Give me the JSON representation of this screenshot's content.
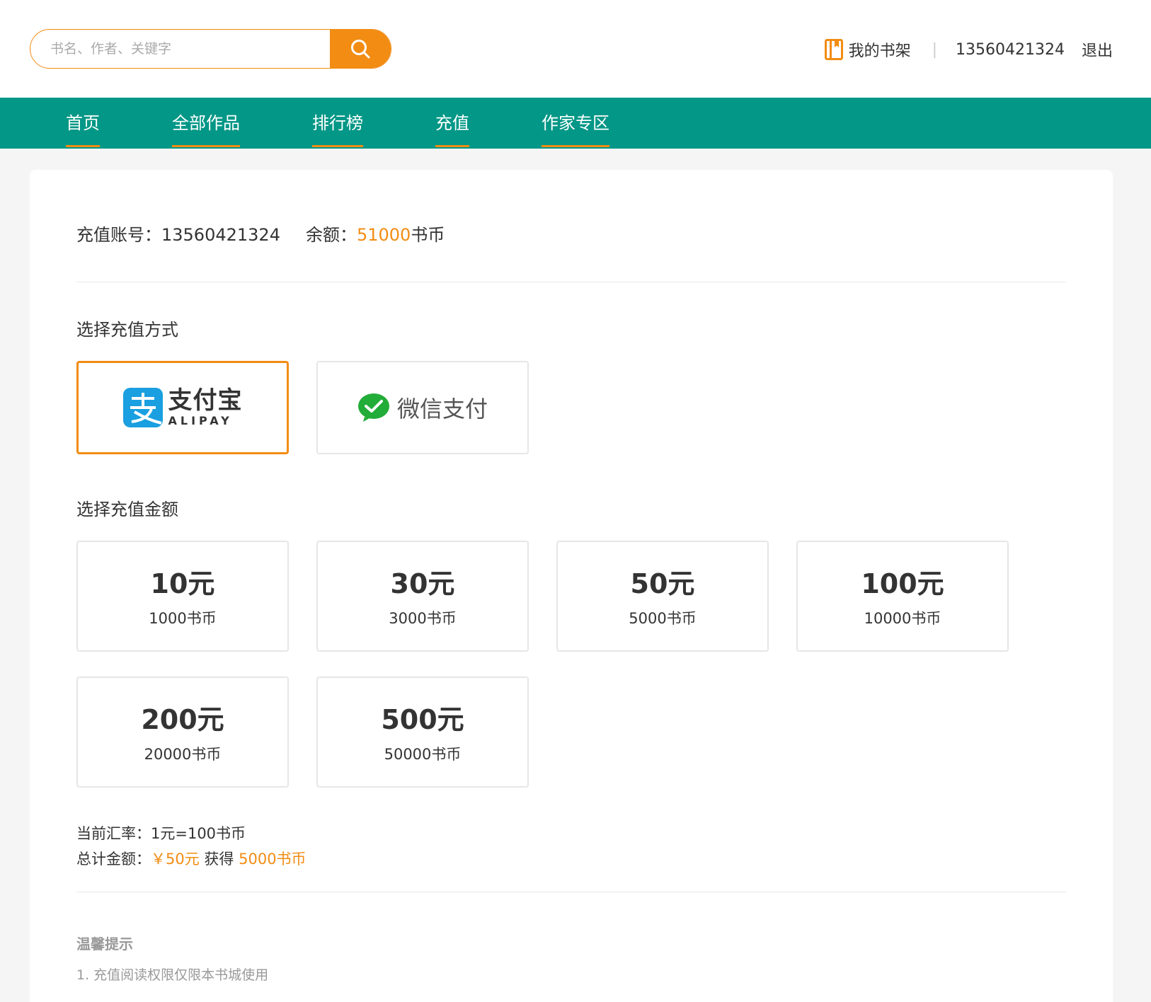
{
  "colors": {
    "accent": "#f28c13",
    "nav_bg": "#029786",
    "page_bg": "#f5f5f5"
  },
  "header": {
    "search": {
      "placeholder": "书名、作者、关键字",
      "button_icon": "search-icon"
    },
    "shelf_icon": "bookshelf-icon",
    "shelf_label": "我的书架",
    "separator": "|",
    "phone": "13560421324",
    "logout_label": "退出"
  },
  "nav": {
    "items": [
      {
        "label": "首页"
      },
      {
        "label": "全部作品"
      },
      {
        "label": "排行榜"
      },
      {
        "label": "充值"
      },
      {
        "label": "作家专区"
      }
    ]
  },
  "account": {
    "label": "充值账号：",
    "value": "13560421324",
    "balance_label": "余额：",
    "balance_value": "51000",
    "balance_unit": "书币"
  },
  "payment": {
    "title": "选择充值方式",
    "selected": "alipay",
    "alipay": {
      "icon": "alipay-icon",
      "name": "支付宝",
      "name_en": "ALIPAY"
    },
    "wechat": {
      "icon": "wechat-pay-icon",
      "name": "微信支付"
    }
  },
  "amounts": {
    "title": "选择充值金额",
    "options": [
      {
        "price": "10元",
        "coins": "1000书币"
      },
      {
        "price": "30元",
        "coins": "3000书币"
      },
      {
        "price": "50元",
        "coins": "5000书币"
      },
      {
        "price": "100元",
        "coins": "10000书币"
      },
      {
        "price": "200元",
        "coins": "20000书币"
      },
      {
        "price": "500元",
        "coins": "50000书币"
      }
    ]
  },
  "summary": {
    "rate_label": "当前汇率：",
    "rate_value": "1元=100书币",
    "total_label": "总计金额：",
    "total_price": "￥50元",
    "get_label": "获得",
    "total_coins": "5000书币"
  },
  "tips": {
    "title": "温馨提示",
    "items": [
      "1. 充值阅读权限仅限本书城使用"
    ]
  }
}
